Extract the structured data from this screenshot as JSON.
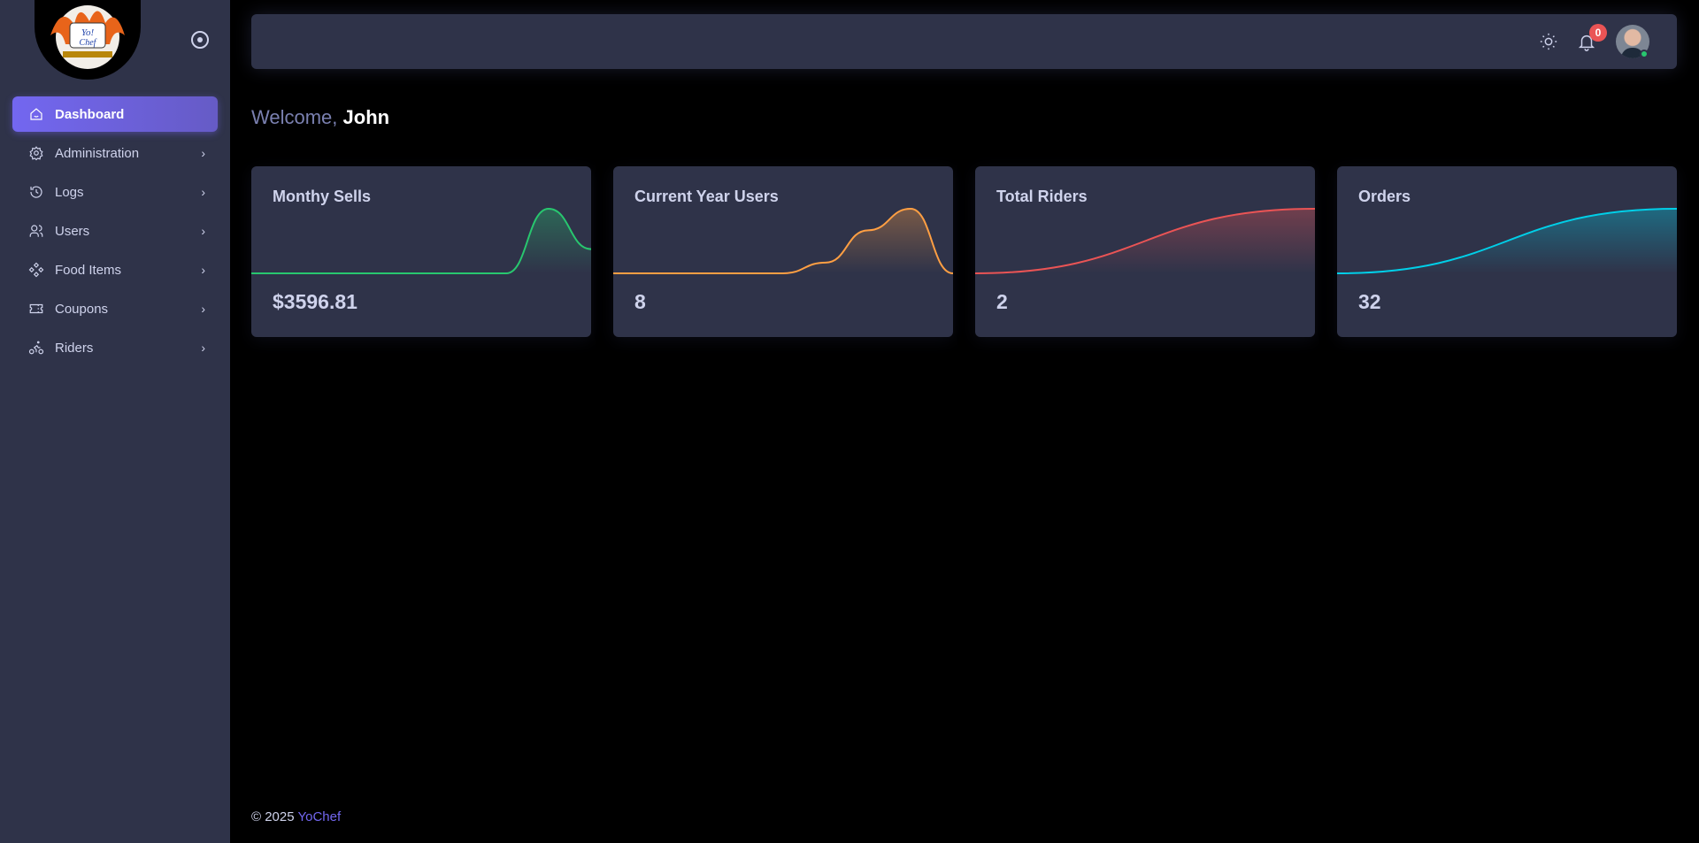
{
  "sidebar": {
    "logo_text": "Yo! Chef",
    "items": [
      {
        "label": "Dashboard",
        "icon": "home-icon",
        "active": true
      },
      {
        "label": "Administration",
        "icon": "gear-icon"
      },
      {
        "label": "Logs",
        "icon": "history-icon"
      },
      {
        "label": "Users",
        "icon": "users-icon"
      },
      {
        "label": "Food Items",
        "icon": "components-icon"
      },
      {
        "label": "Coupons",
        "icon": "ticket-icon"
      },
      {
        "label": "Riders",
        "icon": "bike-icon"
      }
    ]
  },
  "header": {
    "notification_count": "0"
  },
  "welcome": {
    "prefix": "Welcome, ",
    "name": "John"
  },
  "cards": [
    {
      "title": "Monthy Sells",
      "value": "$3596.81",
      "color": "#28c76f"
    },
    {
      "title": "Current Year Users",
      "value": "8",
      "color": "#ff9f43"
    },
    {
      "title": "Total Riders",
      "value": "2",
      "color": "#ea5455"
    },
    {
      "title": "Orders",
      "value": "32",
      "color": "#00cfe8"
    }
  ],
  "chart_data": [
    {
      "type": "area",
      "title": "Monthy Sells",
      "values": [
        0,
        0,
        0,
        0,
        0,
        0,
        0,
        3200,
        1200
      ]
    },
    {
      "type": "area",
      "title": "Current Year Users",
      "values": [
        0,
        0,
        0,
        0,
        0,
        1,
        4,
        6,
        0
      ]
    },
    {
      "type": "area",
      "title": "Total Riders",
      "values": [
        0,
        2
      ]
    },
    {
      "type": "area",
      "title": "Orders",
      "values": [
        0,
        32
      ]
    }
  ],
  "footer": {
    "copyright": "© 2025 ",
    "brand": "YoChef"
  }
}
